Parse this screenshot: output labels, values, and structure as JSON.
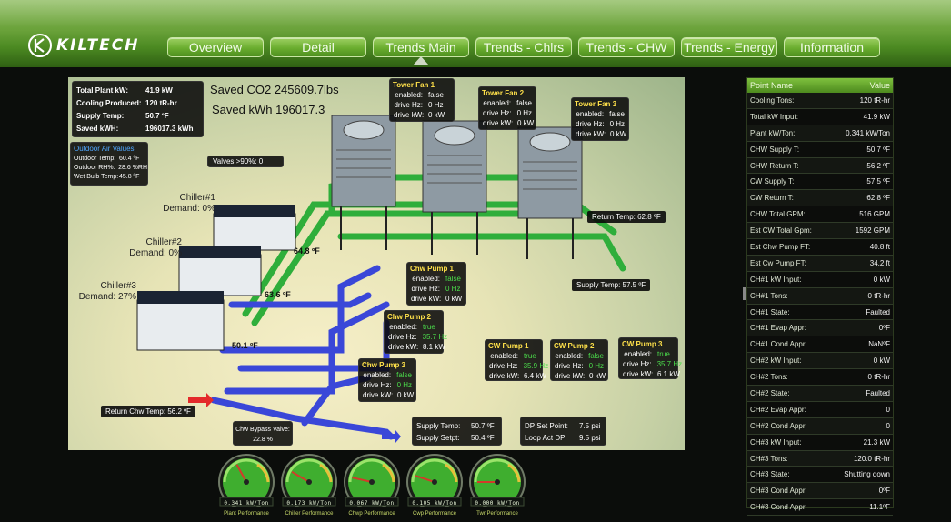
{
  "brand": {
    "logo_text": "KILTECH"
  },
  "nav": {
    "tabs": [
      "Overview",
      "Detail",
      "Trends Main",
      "Trends - Chlrs",
      "Trends - CHW",
      "Trends - Energy",
      "Information"
    ],
    "active": "Trends Main"
  },
  "plant": {
    "rows": [
      {
        "label": "Total Plant kW:",
        "value": "41.9 kW"
      },
      {
        "label": "Cooling Produced:",
        "value": "120 tR-hr"
      },
      {
        "label": "Supply Temp:",
        "value": "50.7 ºF"
      },
      {
        "label": "Saved kWH:",
        "value": "196017.3 kWh"
      }
    ]
  },
  "savings": {
    "co2": "Saved CO2 245609.7lbs",
    "kwh": "Saved kWh 196017.3"
  },
  "outdoor_air": {
    "title": "Outdoor Air Values",
    "rows": [
      {
        "label": "Outdoor Temp:",
        "value": "60.4 ºF"
      },
      {
        "label": "Outdoor RH%:",
        "value": "28.6 %RH"
      },
      {
        "label": "Wet Bulb Temp:",
        "value": "45.8 ºF"
      }
    ]
  },
  "valves": {
    "label": "Valves >90%:",
    "value": "0"
  },
  "chillers": [
    {
      "name": "Chiller#1",
      "demand": "Demand: 0%"
    },
    {
      "name": "Chiller#2",
      "demand": "Demand: 0%"
    },
    {
      "name": "Chiller#3",
      "demand": "Demand: 27%"
    }
  ],
  "tower_fans": [
    {
      "title": "Tower Fan 1",
      "enabled": "false",
      "hz": "0 Hz",
      "kw": "0 kW"
    },
    {
      "title": "Tower Fan 2",
      "enabled": "false",
      "hz": "0 Hz",
      "kw": "0 kW"
    },
    {
      "title": "Tower Fan 3",
      "enabled": "false",
      "hz": "0 Hz",
      "kw": "0 kW"
    }
  ],
  "chw_pumps": [
    {
      "title": "Chw Pump 1",
      "enabled": "false",
      "hz": "0 Hz",
      "kw": "0 kW"
    },
    {
      "title": "Chw Pump 2",
      "enabled": "true",
      "hz": "35.7 Hz",
      "kw": "8.1 kW"
    },
    {
      "title": "Chw Pump 3",
      "enabled": "false",
      "hz": "0 Hz",
      "kw": "0 kW"
    }
  ],
  "cw_pumps": [
    {
      "title": "CW Pump 1",
      "enabled": "true",
      "hz": "35.9 Hz",
      "kw": "6.4 kW"
    },
    {
      "title": "CW Pump 2",
      "enabled": "false",
      "hz": "0 Hz",
      "kw": "0 kW"
    },
    {
      "title": "CW Pump 3",
      "enabled": "true",
      "hz": "35.7 Hz",
      "kw": "6.1 kW"
    }
  ],
  "field_labels": {
    "enabled": "enabled:",
    "hz": "drive Hz:",
    "kw": "drive kW:"
  },
  "temps": {
    "return_temp": "Return Temp: 62.8 ºF",
    "supply_temp": "Supply Temp: 57.5 ºF",
    "return_chw": "Return Chw Temp: 56.2 ºF",
    "pipe_1": "64.8 ºF",
    "pipe_2": "63.6 ºF",
    "pipe_3": "50.1 ºF"
  },
  "bypass": {
    "label": "Chw Bypass Valve:",
    "value": "22.8 %"
  },
  "supply": {
    "rows": [
      {
        "label": "Supply Temp:",
        "value": "50.7 ºF"
      },
      {
        "label": "Supply Setpt:",
        "value": "50.4 ºF"
      }
    ]
  },
  "dp": {
    "rows": [
      {
        "label": "DP Set Point:",
        "value": "7.5 psi"
      },
      {
        "label": "Loop Act DP:",
        "value": "9.5 psi"
      }
    ]
  },
  "gauges": [
    {
      "value": "0.341 kW/Ton",
      "label": "Plant Performance",
      "level": 0.34
    },
    {
      "value": "0.173 kW/Ton",
      "label": "Chiller Performance",
      "level": 0.17
    },
    {
      "value": "0.067 kW/Ton",
      "label": "Chwp Performance",
      "level": 0.07
    },
    {
      "value": "0.105 kW/Ton",
      "label": "Cwp Performance",
      "level": 0.1
    },
    {
      "value": "0.000 kW/Ton",
      "label": "Twr Performance",
      "level": 0.0
    }
  ],
  "point_table": {
    "headers": [
      "Point Name",
      "Value"
    ],
    "rows": [
      [
        "Cooling Tons:",
        "120 tR-hr"
      ],
      [
        "Total kW Input:",
        "41.9 kW"
      ],
      [
        "Plant kW/Ton:",
        "0.341 kW/Ton"
      ],
      [
        "CHW Supply T:",
        "50.7 ºF"
      ],
      [
        "CHW Return T:",
        "56.2 ºF"
      ],
      [
        "CW Supply T:",
        "57.5 ºF"
      ],
      [
        "CW Return T:",
        "62.8 ºF"
      ],
      [
        "CHW Total GPM:",
        "516 GPM"
      ],
      [
        "Est CW Total Gpm:",
        "1592 GPM"
      ],
      [
        "Est Chw Pump FT:",
        "40.8 ft"
      ],
      [
        "Est Cw Pump FT:",
        "34.2 ft"
      ],
      [
        "CH#1 kW Input:",
        "0 kW"
      ],
      [
        "CH#1 Tons:",
        "0 tR-hr"
      ],
      [
        "CH#1 State:",
        "Faulted"
      ],
      [
        "CH#1 Evap Appr:",
        "0ºF"
      ],
      [
        "CH#1 Cond Appr:",
        "NaNºF"
      ],
      [
        "CH#2 kW Input:",
        "0 kW"
      ],
      [
        "CH#2 Tons:",
        "0 tR-hr"
      ],
      [
        "CH#2 State:",
        "Faulted"
      ],
      [
        "CH#2 Evap Appr:",
        "0"
      ],
      [
        "CH#2 Cond Appr:",
        "0"
      ],
      [
        "CH#3 kW Input:",
        "21.3 kW"
      ],
      [
        "CH#3 Tons:",
        "120.0 tR-hr"
      ],
      [
        "CH#3 State:",
        "Shutting down"
      ],
      [
        "CH#3 Cond Appr:",
        "0ºF"
      ],
      [
        "CH#3 Cond Appr:",
        "11.1ºF"
      ]
    ]
  },
  "colors": {
    "header_green": "#6aa23a",
    "nav_green": "#6aad2f",
    "pipe_green": "#2fae3b",
    "pipe_blue": "#3a47d8",
    "true_green": "#4bdd4b",
    "title_yellow": "#ffe14a"
  }
}
